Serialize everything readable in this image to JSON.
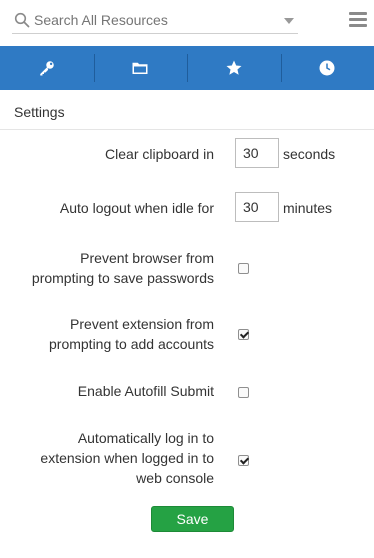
{
  "search": {
    "placeholder": "Search All Resources"
  },
  "tabs": [
    {
      "icon": "key-icon"
    },
    {
      "icon": "folder-icon"
    },
    {
      "icon": "star-icon"
    },
    {
      "icon": "clock-icon"
    }
  ],
  "colors": {
    "tab_bar": "#2f7ac4",
    "save_button": "#25a244"
  },
  "settings": {
    "title": "Settings",
    "clipboard": {
      "label": "Clear clipboard in",
      "value": "30",
      "unit": "seconds"
    },
    "logout": {
      "label": "Auto logout when idle for",
      "value": "30",
      "unit": "minutes"
    },
    "prevent_browser": {
      "label_line1": "Prevent browser from",
      "label_line2": "prompting to save passwords",
      "checked": false
    },
    "prevent_extension": {
      "label_line1": "Prevent extension from",
      "label_line2": "prompting to add accounts",
      "checked": true
    },
    "autofill": {
      "label": "Enable Autofill Submit",
      "checked": false
    },
    "auto_login": {
      "label_line1": "Automatically log in to",
      "label_line2": "extension when logged in to",
      "label_line3": "web console",
      "checked": true
    },
    "save_label": "Save"
  }
}
